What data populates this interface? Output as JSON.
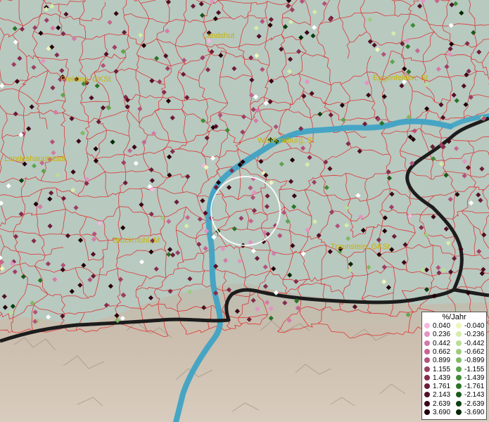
{
  "places": [
    {
      "name": "Landshut"
    },
    {
      "name": "Freising, GKSt"
    },
    {
      "name": "Eggenfelden, St"
    },
    {
      "name": ", Landeshauptstadt"
    },
    {
      "name": "Waldkraiburg, St"
    },
    {
      "name": "Bruckmühl, M"
    },
    {
      "name": "Traunstein, GKSt"
    }
  ],
  "legend": {
    "title": "%/Jahr",
    "positive": [
      {
        "value": "0.040",
        "color": "#f5b6e0"
      },
      {
        "value": "0.236",
        "color": "#e492c4"
      },
      {
        "value": "0.442",
        "color": "#d47aa7"
      },
      {
        "value": "0.662",
        "color": "#c56690"
      },
      {
        "value": "0.899",
        "color": "#b2527a"
      },
      {
        "value": "1.155",
        "color": "#9c3f63"
      },
      {
        "value": "1.439",
        "color": "#852c4d"
      },
      {
        "value": "1.761",
        "color": "#6c1d37"
      },
      {
        "value": "2.143",
        "color": "#521025"
      },
      {
        "value": "2.639",
        "color": "#3a0716"
      },
      {
        "value": "3.690",
        "color": "#220008"
      }
    ],
    "negative": [
      {
        "value": "-0.040",
        "color": "#eef7b8"
      },
      {
        "value": "-0.236",
        "color": "#d5ecaa"
      },
      {
        "value": "-0.442",
        "color": "#b9dd93"
      },
      {
        "value": "-0.662",
        "color": "#9ccc7c"
      },
      {
        "value": "-0.899",
        "color": "#7fba66"
      },
      {
        "value": "-1.155",
        "color": "#5ea44d"
      },
      {
        "value": "-1.439",
        "color": "#3f8c36"
      },
      {
        "value": "-1.761",
        "color": "#2a7328"
      },
      {
        "value": "-2.143",
        "color": "#175a1b"
      },
      {
        "value": "-2.639",
        "color": "#0b4010"
      },
      {
        "value": "-3.690",
        "color": "#022805"
      }
    ]
  },
  "colors": {
    "land": "#b9c9c0",
    "alps": "#c9bcae",
    "river": "#3fa3c4",
    "municipal_border": "#e02020",
    "state_border": "#1a1a1a",
    "label": "#c8b400"
  }
}
